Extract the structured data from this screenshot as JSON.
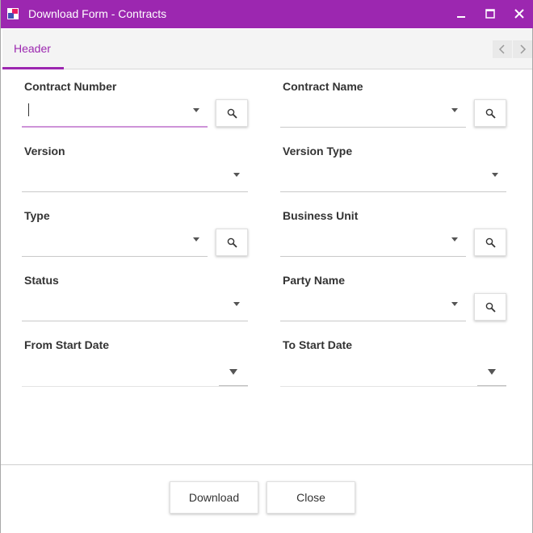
{
  "window": {
    "title": "Download Form - Contracts",
    "accent_color": "#9c27b0"
  },
  "tabs": [
    {
      "label": "Header",
      "active": true
    }
  ],
  "form": {
    "contract_number": {
      "label": "Contract Number",
      "value": ""
    },
    "contract_name": {
      "label": "Contract Name",
      "value": ""
    },
    "version": {
      "label": "Version",
      "value": ""
    },
    "version_type": {
      "label": "Version Type",
      "value": ""
    },
    "type": {
      "label": "Type",
      "value": ""
    },
    "business_unit": {
      "label": "Business Unit",
      "value": ""
    },
    "status": {
      "label": "Status",
      "value": ""
    },
    "party_name": {
      "label": "Party Name",
      "value": ""
    },
    "from_start_date": {
      "label": "From Start Date",
      "value": ""
    },
    "to_start_date": {
      "label": "To Start Date",
      "value": ""
    }
  },
  "footer": {
    "download_label": "Download",
    "close_label": "Close"
  },
  "icons": {
    "search": "search-icon",
    "dropdown": "chevron-down-icon",
    "minimize": "minimize-icon",
    "maximize": "maximize-icon",
    "close": "close-icon"
  }
}
